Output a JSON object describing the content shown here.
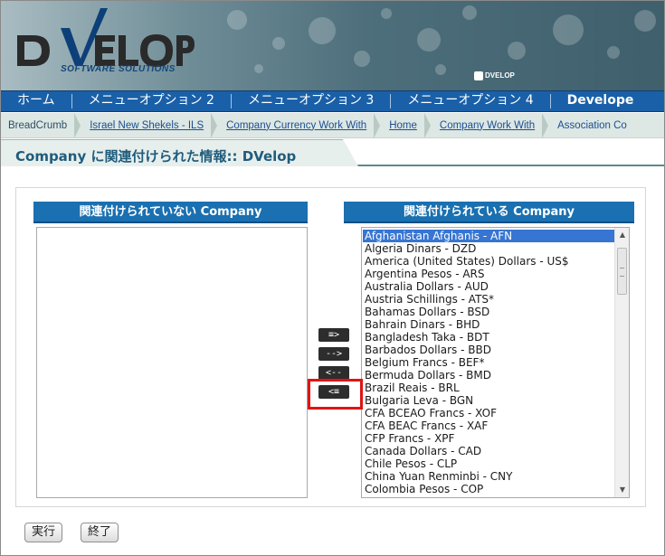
{
  "header": {
    "logo_text": "DVELOP",
    "logo_sub": "SOFTWARE SOLUTIONS",
    "mini_logo_text": "DVELOP"
  },
  "nav": {
    "items": [
      {
        "label": "ホーム"
      },
      {
        "label": "メニューオプション 2"
      },
      {
        "label": "メニューオプション 3"
      },
      {
        "label": "メニューオプション 4"
      },
      {
        "label": "Develope"
      }
    ]
  },
  "breadcrumb": {
    "items": [
      {
        "label": "BreadCrumb"
      },
      {
        "label": "Israel New Shekels - ILS"
      },
      {
        "label": "Company Currency Work With"
      },
      {
        "label": "Home"
      },
      {
        "label": "Company Work With"
      },
      {
        "label": "Association Co"
      }
    ]
  },
  "page": {
    "title": "Company に関連付けられた情報:: DVelop"
  },
  "association": {
    "left_header": "関連付けられていない  Company",
    "right_header": "関連付けられている  Company",
    "selected_index": 0,
    "right_items": [
      "Afghanistan Afghanis - AFN",
      "Algeria Dinars - DZD",
      "America (United States) Dollars - US$",
      "Argentina Pesos - ARS",
      "Australia Dollars - AUD",
      "Austria Schillings - ATS*",
      "Bahamas Dollars - BSD",
      "Bahrain Dinars - BHD",
      "Bangladesh Taka - BDT",
      "Barbados Dollars - BBD",
      "Belgium Francs - BEF*",
      "Bermuda Dollars - BMD",
      "Brazil Reais - BRL",
      "Bulgaria Leva - BGN",
      "CFA BCEAO Francs - XOF",
      "CFA BEAC Francs - XAF",
      "CFP Francs - XPF",
      "Canada Dollars - CAD",
      "Chile Pesos - CLP",
      "China Yuan Renminbi - CNY",
      "Colombia Pesos - COP"
    ],
    "buttons": {
      "add_all": "≡>",
      "add_one": "-->",
      "remove_one": "<--",
      "remove_all": "<≡"
    }
  },
  "footer": {
    "run_label": "実行",
    "end_label": "終了"
  }
}
